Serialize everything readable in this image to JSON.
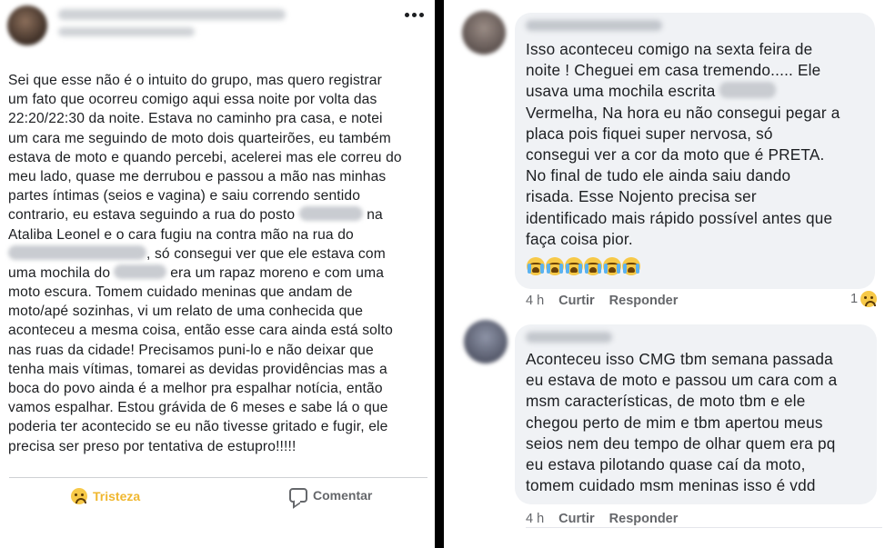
{
  "post": {
    "text_lines": [
      [
        "Sei que esse não é o intuito do grupo, mas quero registrar"
      ],
      [
        "um fato que ocorreu comigo aqui essa noite por volta das"
      ],
      [
        "22:20/22:30 da noite. Estava no caminho pra casa, e notei"
      ],
      [
        "um cara me seguindo de moto dois quarteirões, eu também"
      ],
      [
        "estava de moto e quando percebi, acelerei mas ele correu do"
      ],
      [
        "meu lado, quase me derrubou e passou a mão nas minhas"
      ],
      [
        "partes íntimas (seios e vagina) e saiu correndo sentido"
      ],
      [
        "contrario, eu estava seguindo a rua do posto",
        "na"
      ],
      [
        "Ataliba Leonel e o cara fugiu na contra mão na rua do"
      ],
      [
        "",
        ", só consegui ver que ele estava com"
      ],
      [
        "uma mochila do",
        "era um rapaz moreno e com uma"
      ],
      [
        "moto escura. Tomem cuidado meninas que andam de"
      ],
      [
        "moto/apé sozinhas, vi um relato de uma conhecida que"
      ],
      [
        "aconteceu a mesma coisa, então esse cara ainda está solto"
      ],
      [
        "nas ruas da cidade! Precisamos puni-lo e não deixar que"
      ],
      [
        "tenha mais vítimas, tomarei as devidas providências mas a"
      ],
      [
        "boca do povo ainda é a melhor pra espalhar notícia, então"
      ],
      [
        "vamos espalhar. Estou grávida de 6 meses e sabe lá o que"
      ],
      [
        "poderia ter acontecido se eu não tivesse gritado e fugir, ele"
      ],
      [
        "precisa ser preso por tentativa de estupro!!!!!"
      ]
    ],
    "reaction_label": "Tristeza",
    "comment_label": "Comentar",
    "more_icon": "more-horizontal-icon"
  },
  "comments": [
    {
      "text_lines": [
        [
          "Isso aconteceu comigo na sexta feira de"
        ],
        [
          "noite ! Cheguei em casa tremendo..... Ele"
        ],
        [
          "usava uma mochila escrita"
        ],
        [
          "Vermelha, Na hora eu não consegui pegar a"
        ],
        [
          "placa pois fiquei super nervosa, só"
        ],
        [
          "consegui ver a cor da moto que é PRETA."
        ],
        [
          "No final de tudo ele ainda saiu dando"
        ],
        [
          "risada. Esse Nojento precisa ser"
        ],
        [
          "identificado mais rápido possível antes que"
        ],
        [
          "faça coisa pior."
        ]
      ],
      "emoji_count": 6,
      "emoji_icon": "loudly-crying-face-icon",
      "time": "4 h",
      "like_label": "Curtir",
      "reply_label": "Responder",
      "reaction_count": "1"
    },
    {
      "text_lines": [
        [
          "Aconteceu isso CMG tbm semana passada"
        ],
        [
          "eu estava de moto e passou um cara com a"
        ],
        [
          "msm características,  de moto tbm e ele"
        ],
        [
          "chegou perto de mim e tbm apertou meus"
        ],
        [
          "seios nem deu tempo de olhar quem era pq"
        ],
        [
          "eu estava pilotando  quase caí da moto,"
        ],
        [
          "tomem cuidado msm meninas isso é vdd"
        ]
      ],
      "time": "4 h",
      "like_label": "Curtir",
      "reply_label": "Responder"
    }
  ]
}
